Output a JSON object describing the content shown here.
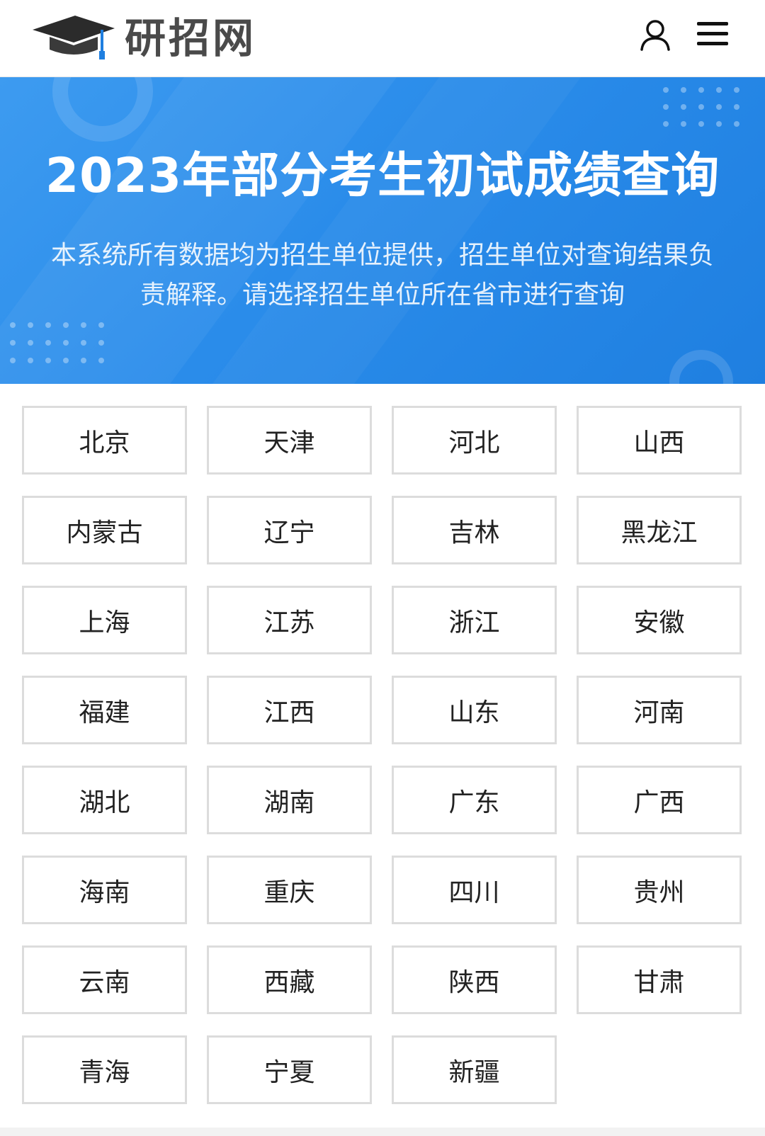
{
  "header": {
    "logo_text": "研招网",
    "user_icon": "user-icon",
    "menu_icon": "hamburger-menu-icon"
  },
  "banner": {
    "title": "2023年部分考生初试成绩查询",
    "description": "本系统所有数据均为招生单位提供，招生单位对查询结果负责解释。请选择招生单位所在省市进行查询",
    "background_color": "#2a8cea"
  },
  "provinces": [
    "北京",
    "天津",
    "河北",
    "山西",
    "内蒙古",
    "辽宁",
    "吉林",
    "黑龙江",
    "上海",
    "江苏",
    "浙江",
    "安徽",
    "福建",
    "江西",
    "山东",
    "河南",
    "湖北",
    "湖南",
    "广东",
    "广西",
    "海南",
    "重庆",
    "四川",
    "贵州",
    "云南",
    "西藏",
    "陕西",
    "甘肃",
    "青海",
    "宁夏",
    "新疆"
  ]
}
